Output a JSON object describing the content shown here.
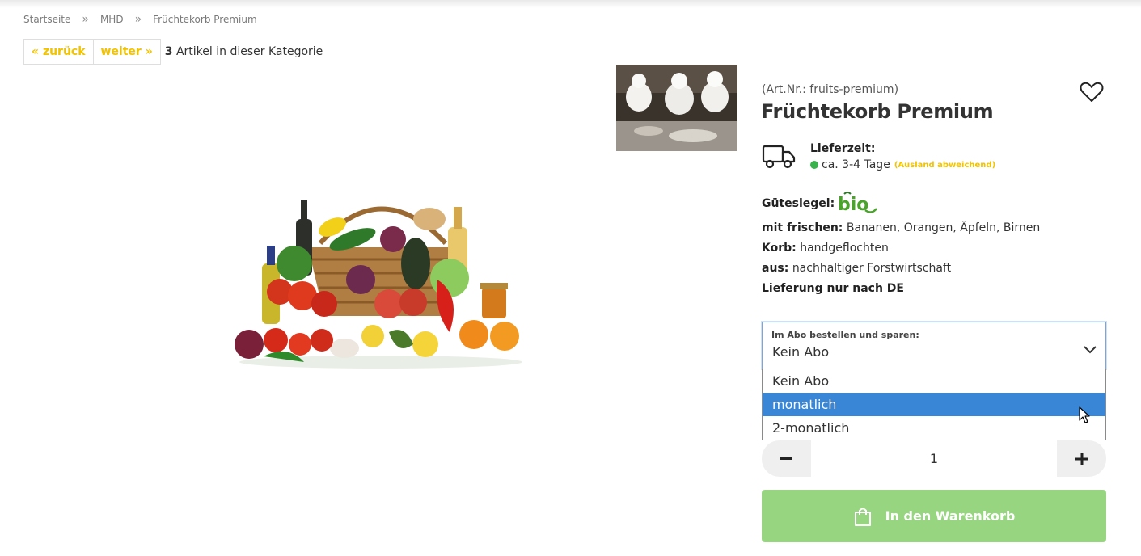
{
  "breadcrumb": {
    "items": [
      "Startseite",
      "MHD",
      "Früchtekorb Premium"
    ],
    "separator": "»"
  },
  "pager": {
    "prev_label": "« zurück",
    "next_label": "weiter »",
    "count": "3",
    "count_text": "Artikel in dieser Kategorie"
  },
  "product": {
    "art_nr": "(Art.Nr.: fruits-premium)",
    "title": "Früchtekorb Premium",
    "delivery_label": "Lieferzeit:",
    "delivery_time": "ca. 3-4 Tage",
    "delivery_note": "(Ausland abweichend)",
    "seal_label": "Gütesiegel:",
    "seal_logo_text": "bio",
    "properties": [
      {
        "key": "mit frischen:",
        "value": "Bananen, Orangen, Äpfeln, Birnen"
      },
      {
        "key": "Korb:",
        "value": "handgeflochten"
      },
      {
        "key": "aus:",
        "value": "nachhaltiger Forstwirtschaft"
      },
      {
        "key": "Lieferung nur nach DE",
        "value": ""
      }
    ]
  },
  "subscription": {
    "label": "Im Abo bestellen und sparen:",
    "selected": "Kein Abo",
    "options": [
      "Kein Abo",
      "monatlich",
      "2-monatlich"
    ],
    "highlighted": "monatlich"
  },
  "quantity": {
    "value": "1"
  },
  "cart_button": {
    "label": "In den Warenkorb"
  },
  "colors": {
    "accent_yellow": "#f2c400",
    "cart_green": "#98d581",
    "status_green": "#38b24a",
    "highlight_blue": "#3a86d6"
  },
  "icons": {
    "wishlist": "heart-icon",
    "delivery": "truck-icon",
    "dropdown": "chevron-down-icon",
    "cart": "shopping-bag-icon",
    "decrease": "minus-icon",
    "increase": "plus-icon"
  }
}
